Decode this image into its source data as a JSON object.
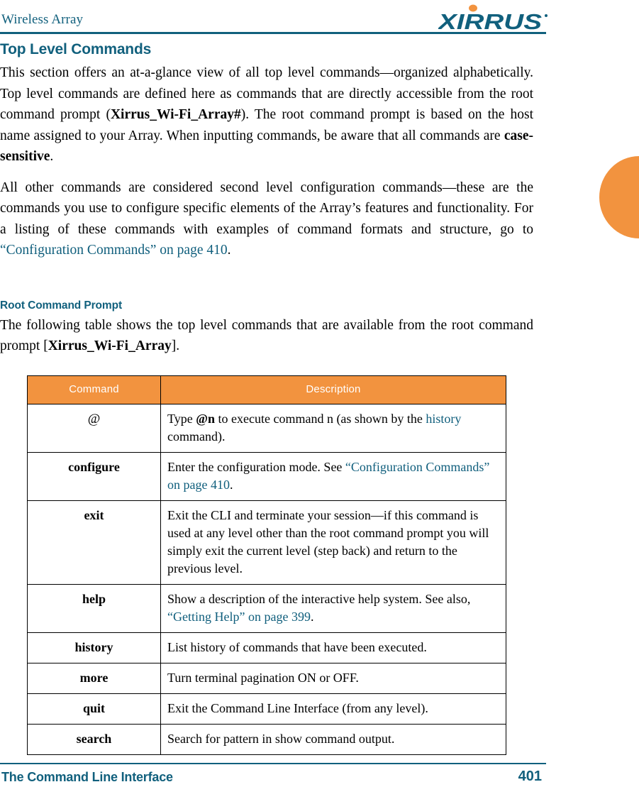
{
  "header": {
    "running_title": "Wireless Array",
    "logo_name": "xirrus-logo",
    "logo_wordmark": "XIRRUS",
    "logo_color": "#11607D",
    "logo_dot_color": "#F2933F"
  },
  "colors": {
    "accent_teal": "#11607D",
    "accent_orange": "#F2933F",
    "link_teal": "#0F5E7C",
    "text": "#000000"
  },
  "section": {
    "title": "Top Level Commands",
    "paragraph_1": {
      "part_1": "This section offers an at-a-glance view of all top level commands—organized alphabetically. Top level commands are defined here as commands that are directly accessible from the root command prompt (",
      "bold_1": "Xirrus_Wi-Fi_Array#",
      "part_2": "). The root command prompt is based on the host name assigned to your Array. When inputting commands, be aware that all commands are ",
      "bold_2": "case-sensitive",
      "part_3": "."
    },
    "paragraph_2": {
      "part_1": "All other commands are considered second level configuration commands—these are the commands you use to configure specific elements of the Array’s features and functionality. For a listing of these commands with examples of command formats and structure, go to ",
      "link": "“Configuration Commands” on page 410",
      "part_2": "."
    }
  },
  "subsection": {
    "title": "Root Command Prompt",
    "paragraph": {
      "part_1": "The following table shows the top level commands that are available from the root command prompt [",
      "bold_1": "Xirrus_Wi-Fi_Array",
      "part_2": "]."
    }
  },
  "table": {
    "columns": [
      "Command",
      "Description"
    ],
    "rows": [
      {
        "command": "@",
        "command_style": "plain",
        "description_parts": [
          {
            "text": "Type ",
            "style": "normal"
          },
          {
            "text": "@n",
            "style": "bold"
          },
          {
            "text": " to execute command n (as shown by the ",
            "style": "normal"
          },
          {
            "text": "history",
            "style": "link"
          },
          {
            "text": " command).",
            "style": "normal"
          }
        ]
      },
      {
        "command": "configure",
        "command_style": "bold",
        "description_parts": [
          {
            "text": "Enter the configuration mode. See ",
            "style": "normal"
          },
          {
            "text": "“Configuration Commands” on page 410",
            "style": "link"
          },
          {
            "text": ".",
            "style": "normal"
          }
        ]
      },
      {
        "command": "exit",
        "command_style": "bold",
        "description_parts": [
          {
            "text": "Exit the CLI and terminate your session—if this command is used at any level other than the root command prompt you will simply exit the current level (step back) and return to the previous level.",
            "style": "normal"
          }
        ]
      },
      {
        "command": "help",
        "command_style": "bold",
        "description_parts": [
          {
            "text": "Show a description of the interactive help system. See also, ",
            "style": "normal"
          },
          {
            "text": "“Getting Help” on page 399",
            "style": "link"
          },
          {
            "text": ".",
            "style": "normal"
          }
        ]
      },
      {
        "command": "history",
        "command_style": "bold",
        "description_parts": [
          {
            "text": "List history of commands that have been executed.",
            "style": "normal"
          }
        ]
      },
      {
        "command": "more",
        "command_style": "bold",
        "description_parts": [
          {
            "text": "Turn terminal pagination ON or OFF.",
            "style": "normal"
          }
        ]
      },
      {
        "command": "quit",
        "command_style": "bold",
        "description_parts": [
          {
            "text": "Exit the Command Line Interface (from any level).",
            "style": "normal"
          }
        ]
      },
      {
        "command": "search",
        "command_style": "bold",
        "description_parts": [
          {
            "text": "Search for pattern in show command output.",
            "style": "normal"
          }
        ]
      }
    ]
  },
  "footer": {
    "chapter_title": "The Command Line Interface",
    "page_number": "401"
  }
}
